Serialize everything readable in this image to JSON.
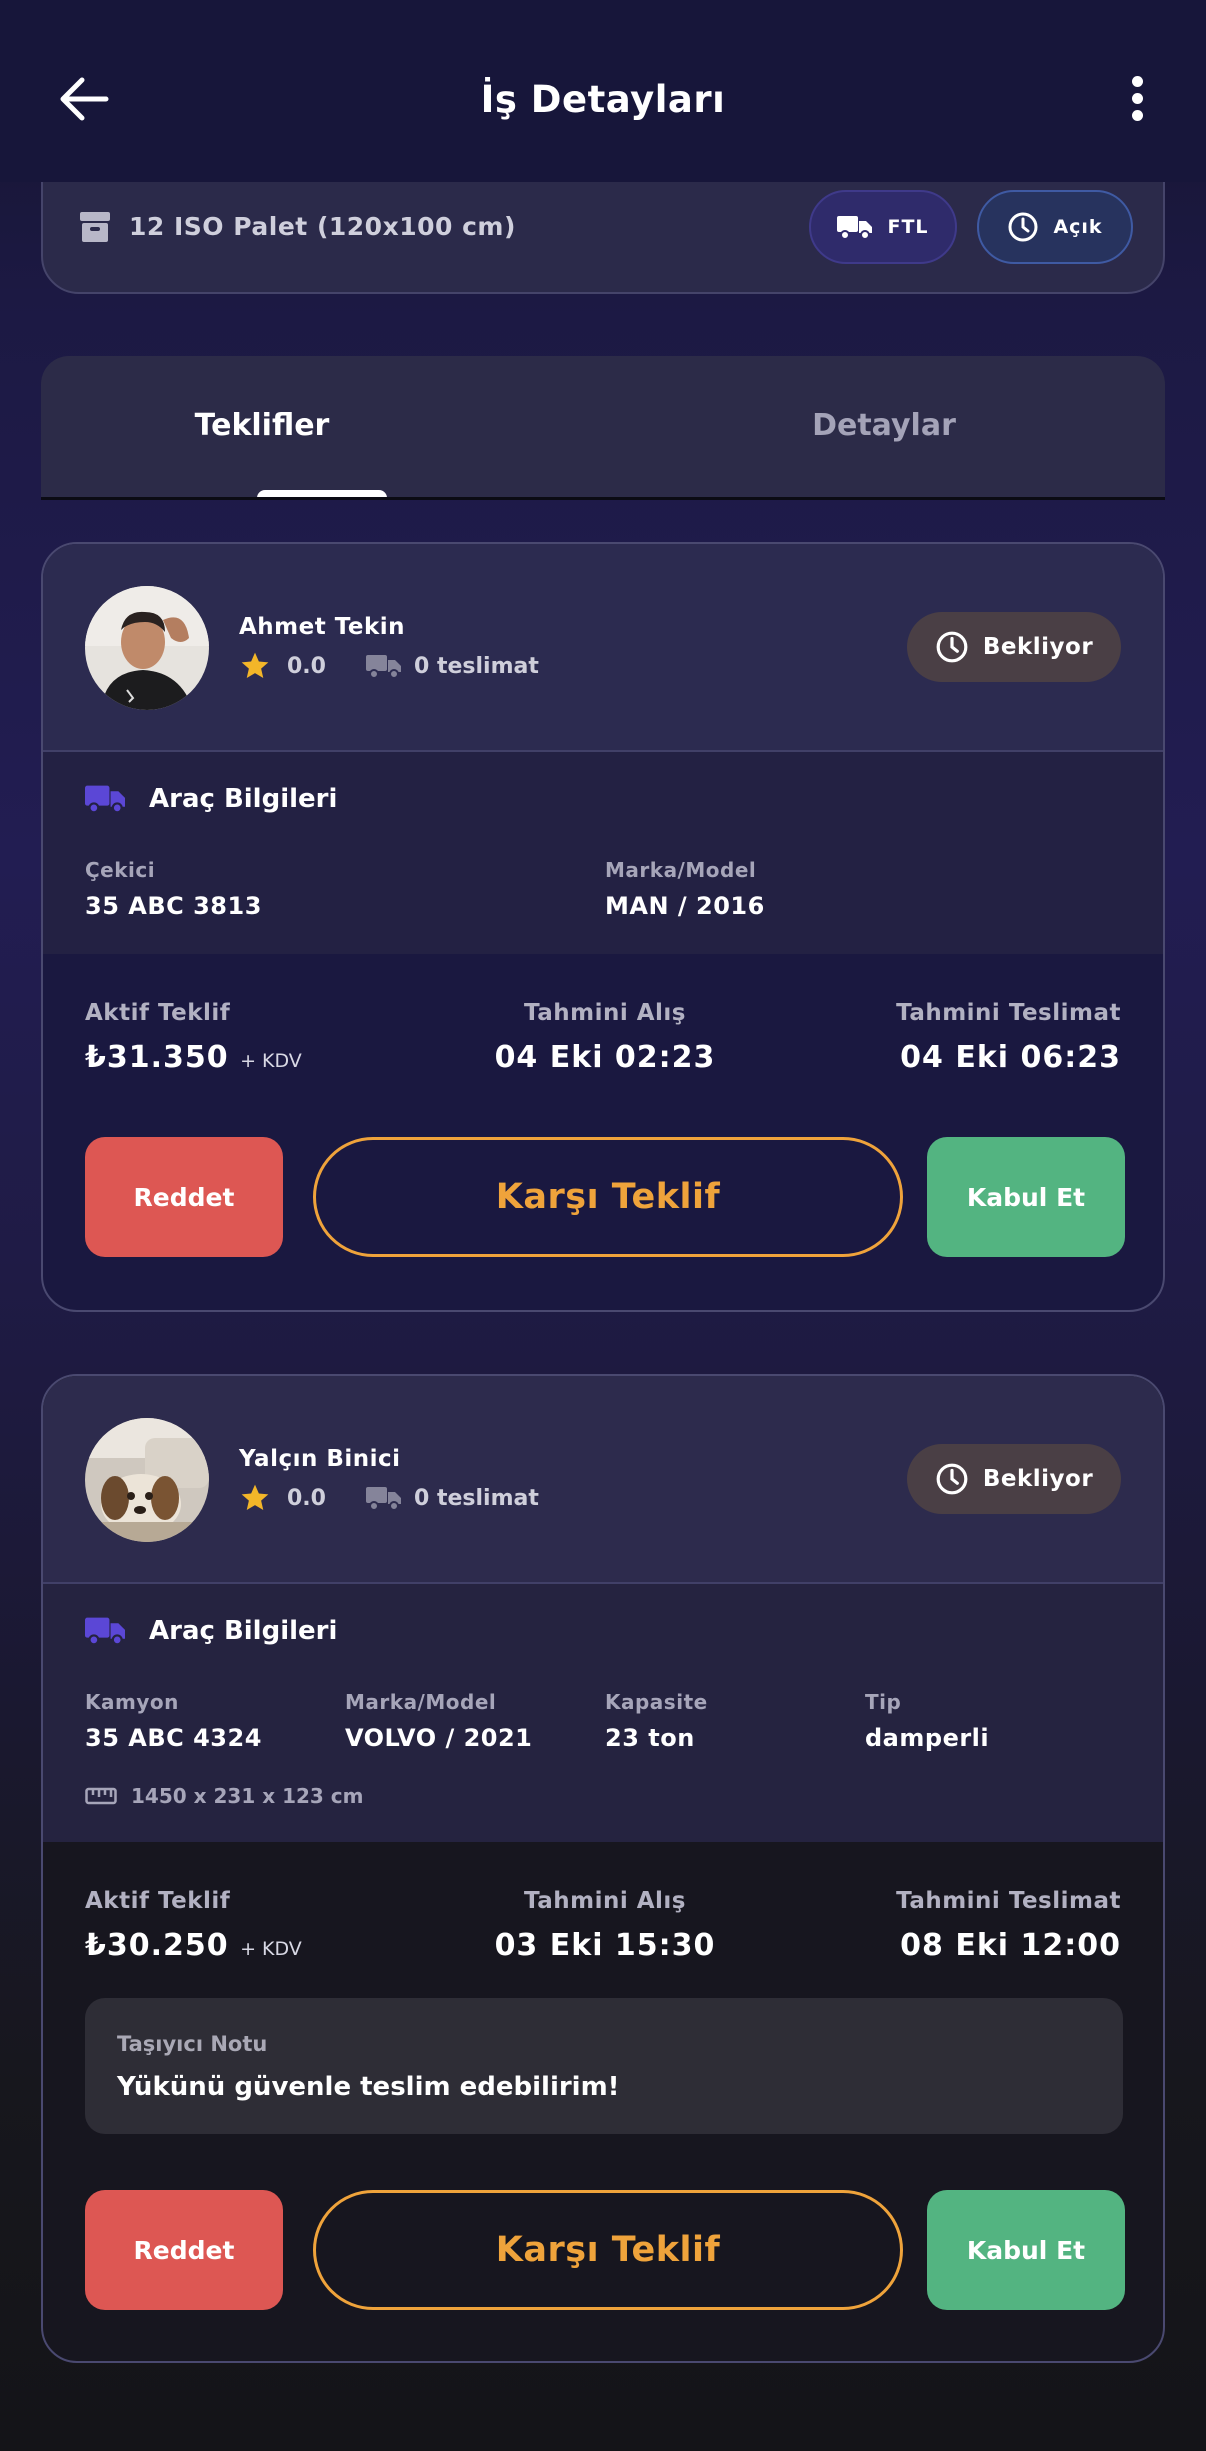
{
  "header": {
    "title": "İş Detayları"
  },
  "job": {
    "cargo": "12 ISO Palet (120x100 cm)",
    "type_badge": "FTL",
    "status_badge": "Açık"
  },
  "tabs": [
    {
      "label": "Teklifler"
    },
    {
      "label": "Detaylar"
    }
  ],
  "offers": [
    {
      "name": "Ahmet Tekin",
      "rating": "0.0",
      "deliveries": "0 teslimat",
      "status": "Bekliyor",
      "vehicle_title": "Araç Bilgileri",
      "specs": [
        {
          "label": "Çekici",
          "value": "35 ABC 3813"
        },
        {
          "label": "Marka/Model",
          "value": "MAN / 2016"
        }
      ],
      "active_offer_label": "Aktif Teklif",
      "price": "₺31.350",
      "tax": "+ KDV",
      "pickup_label": "Tahmini Alış",
      "pickup": "04 Eki 02:23",
      "delivery_label": "Tahmini Teslimat",
      "delivery": "04 Eki 06:23",
      "reject": "Reddet",
      "counter": "Karşı Teklif",
      "accept": "Kabul Et"
    },
    {
      "name": "Yalçın Binici",
      "rating": "0.0",
      "deliveries": "0 teslimat",
      "status": "Bekliyor",
      "vehicle_title": "Araç Bilgileri",
      "specs": [
        {
          "label": "Kamyon",
          "value": "35 ABC 4324"
        },
        {
          "label": "Marka/Model",
          "value": "VOLVO / 2021"
        },
        {
          "label": "Kapasite",
          "value": "23 ton"
        },
        {
          "label": "Tip",
          "value": "damperli"
        }
      ],
      "dimensions": "1450 x 231 x 123 cm",
      "active_offer_label": "Aktif Teklif",
      "price": "₺30.250",
      "tax": "+ KDV",
      "pickup_label": "Tahmini Alış",
      "pickup": "03 Eki 15:30",
      "delivery_label": "Tahmini Teslimat",
      "delivery": "08 Eki 12:00",
      "note_label": "Taşıyıcı Notu",
      "note": "Yükünü güvenle teslim edebilirim!",
      "reject": "Reddet",
      "counter": "Karşı Teklif",
      "accept": "Kabul Et"
    }
  ],
  "colors": {
    "accent_orange": "#efa33b",
    "reject_red": "#dd5753",
    "accept_green": "#53b481",
    "truck_purple": "#5b47d6",
    "star_yellow": "#f3b629"
  },
  "icons": [
    "back-arrow-icon",
    "more-vertical-icon",
    "archive-box-icon",
    "truck-icon",
    "clock-icon",
    "star-icon",
    "ruler-icon"
  ]
}
